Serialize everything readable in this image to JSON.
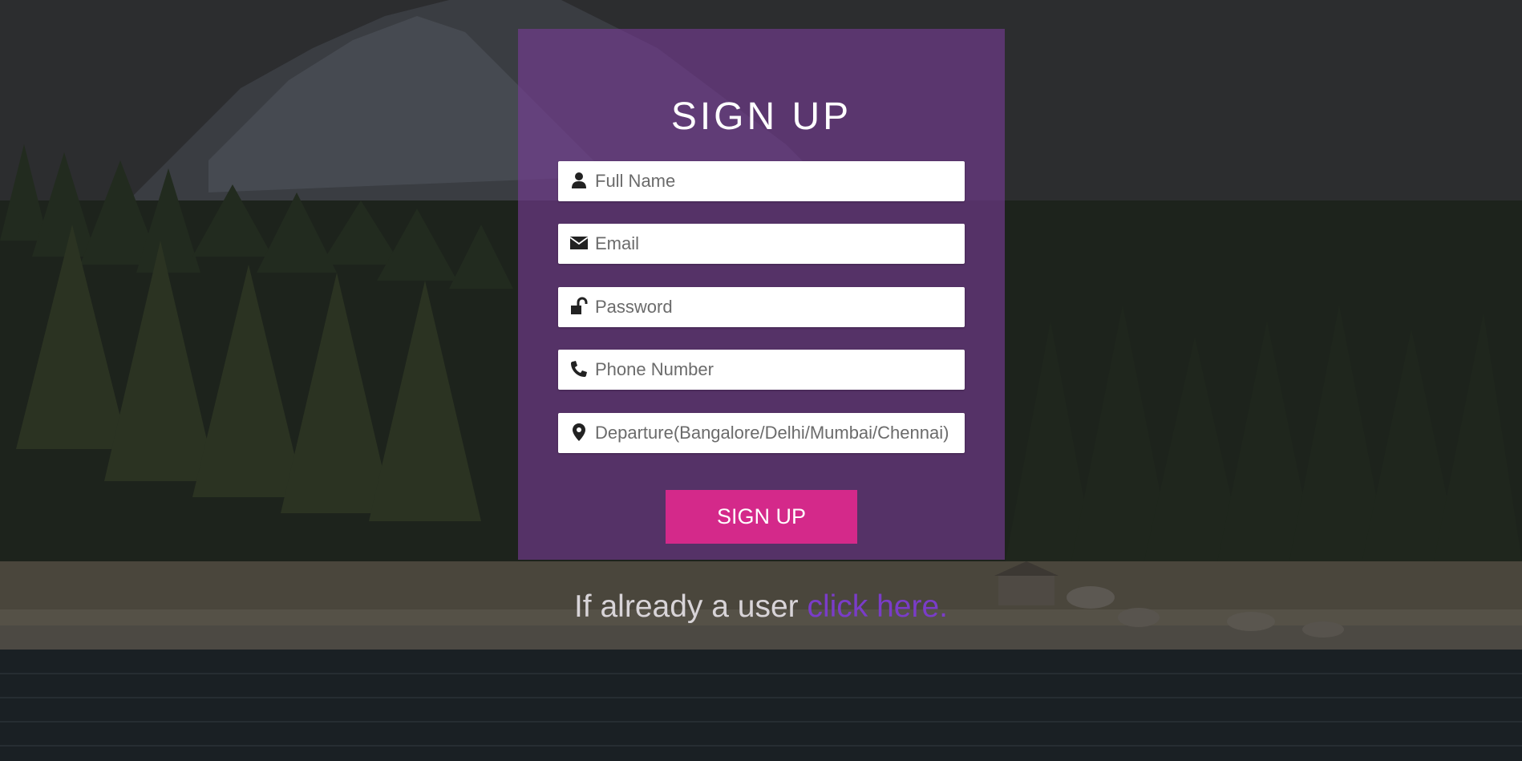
{
  "form": {
    "title": "SIGN UP",
    "fields": [
      {
        "name": "full-name",
        "placeholder": "Full Name",
        "value": "",
        "icon": "user-icon"
      },
      {
        "name": "email",
        "placeholder": "Email",
        "value": "",
        "icon": "envelope-icon"
      },
      {
        "name": "password",
        "placeholder": "Password",
        "value": "",
        "icon": "unlock-icon"
      },
      {
        "name": "phone",
        "placeholder": "Phone Number",
        "value": "",
        "icon": "phone-icon"
      },
      {
        "name": "departure",
        "placeholder": "Departure(Bangalore/Delhi/Mumbai/Chennai)",
        "value": "",
        "icon": "map-pin-icon"
      }
    ],
    "submit_label": "SIGN UP"
  },
  "footer": {
    "prompt_text": "If already a user ",
    "link_text": "click here."
  },
  "colors": {
    "card_bg": "#7d3f9a",
    "button_bg": "#d4298a",
    "link": "#7a3cc8"
  }
}
